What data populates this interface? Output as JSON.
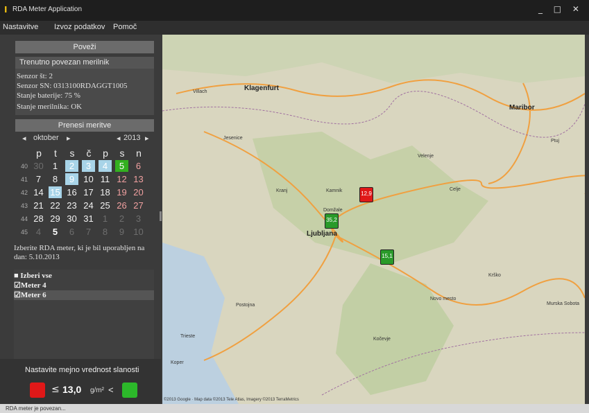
{
  "window": {
    "title": "RDA Meter Application",
    "controls": "_ □ ✕"
  },
  "menu": [
    "Nastavitve",
    "Izvoz podatkov",
    "Pomoč"
  ],
  "left": {
    "connect_button": "Poveži",
    "connected_header": "Trenutno povezan merilnik",
    "sensor_no": "Senzor št:  2",
    "sensor_sn": "Senzor SN:  0313100RDAGGT1005",
    "battery": "Stanje baterije:  75 %",
    "meter_state": "Stanje merilnika: OK",
    "transfer_button": "Prenesi meritve",
    "calendar": {
      "month": "oktober",
      "year": "2013",
      "prev_month": "◂",
      "next_month": "▸",
      "prev_year": "◂",
      "next_year": "▸",
      "days_of_week": [
        "p",
        "t",
        "s",
        "č",
        "p",
        "s",
        "n"
      ],
      "weeks": [
        "40",
        "41",
        "42",
        "43",
        "44",
        "45"
      ],
      "rows": [
        [
          "30",
          "1",
          "2",
          "3",
          "4",
          "5",
          "6"
        ],
        [
          "7",
          "8",
          "9",
          "10",
          "11",
          "12",
          "13"
        ],
        [
          "14",
          "15",
          "16",
          "17",
          "18",
          "19",
          "20"
        ],
        [
          "21",
          "22",
          "23",
          "24",
          "25",
          "26",
          "27"
        ],
        [
          "28",
          "29",
          "30",
          "31",
          "1",
          "2",
          "3"
        ],
        [
          "4",
          "5",
          "6",
          "7",
          "8",
          "9",
          "10"
        ]
      ]
    },
    "pick_text": "Izberite RDA meter, ki je bil uporabljen na dan: 5.10.2013",
    "meters": [
      {
        "label": "Izberi vse",
        "prefix": "■"
      },
      {
        "label": "Meter 4",
        "prefix": "☑"
      },
      {
        "label": "Meter 6",
        "prefix": "☑"
      }
    ],
    "limit_label": "Nastavite mejno vrednost slanosti",
    "limit": {
      "leq": "≤",
      "value": "13,0",
      "unit": "g/m²",
      "lt": "<"
    },
    "colors": {
      "red": "#e01818",
      "green": "#2cb82a",
      "selected": "#a8d4e8",
      "today": "#33b020"
    }
  },
  "map": {
    "cities": [
      "Ljubljana",
      "Kranj",
      "Kamnik",
      "Domžale",
      "Celje",
      "Maribor",
      "Novo mesto",
      "Krško",
      "Kočevje",
      "Postojna",
      "Jesenice",
      "Velenje",
      "Klagenfurt",
      "Villach",
      "Trieste",
      "Koper",
      "Ptuj",
      "Murska Sobota"
    ],
    "markers": [
      {
        "value": "12,9",
        "status": "red"
      },
      {
        "value": "35,2",
        "status": "green"
      },
      {
        "value": "15,1",
        "status": "green"
      }
    ],
    "attribution": "©2013 Google · Map data ©2013 Tele Atlas, Imagery ©2013 TerraMetrics"
  },
  "status": {
    "text": "RDA meter je povezan..."
  }
}
